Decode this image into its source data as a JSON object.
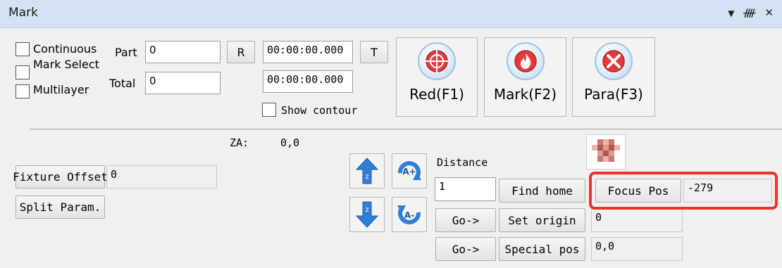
{
  "window": {
    "title": "Mark",
    "icons": [
      "dropdown-icon",
      "pin-icon",
      "close-icon"
    ],
    "icon_glyphs": [
      "▼",
      "ᚎ",
      "✕"
    ]
  },
  "options": {
    "continuous": "Continuous",
    "mark_select": "Mark Select",
    "multilayer": "Multilayer"
  },
  "counters": {
    "part_label": "Part",
    "part_value": "0",
    "total_label": "Total",
    "total_value": "0",
    "reset_label": "R"
  },
  "timers": {
    "time1": "00:00:00.000",
    "time2": "00:00:00.000",
    "t_label": "T",
    "show_contour": "Show contour"
  },
  "actions": {
    "red": "Red(F1)",
    "mark": "Mark(F2)",
    "para": "Para(F3)"
  },
  "za": {
    "label": "ZA:",
    "value": "0,0"
  },
  "fixture": {
    "offset_label": "Fixture Offset",
    "offset_value": "0",
    "split_label": "Split Param."
  },
  "motion": {
    "distance_label": "Distance",
    "distance_value": "1",
    "find_home": "Find home",
    "focus_pos": "Focus Pos",
    "focus_value": "-279",
    "go1": "Go->",
    "set_origin": "Set origin",
    "origin_value": "0",
    "go2": "Go->",
    "special_pos": "Special pos",
    "special_value": "0,0"
  },
  "colors": {
    "titlebar": "#d6e2f3",
    "highlight": "#e8342a",
    "icon_blue": "#2f7fd6",
    "icon_red": "#e23b3b"
  }
}
